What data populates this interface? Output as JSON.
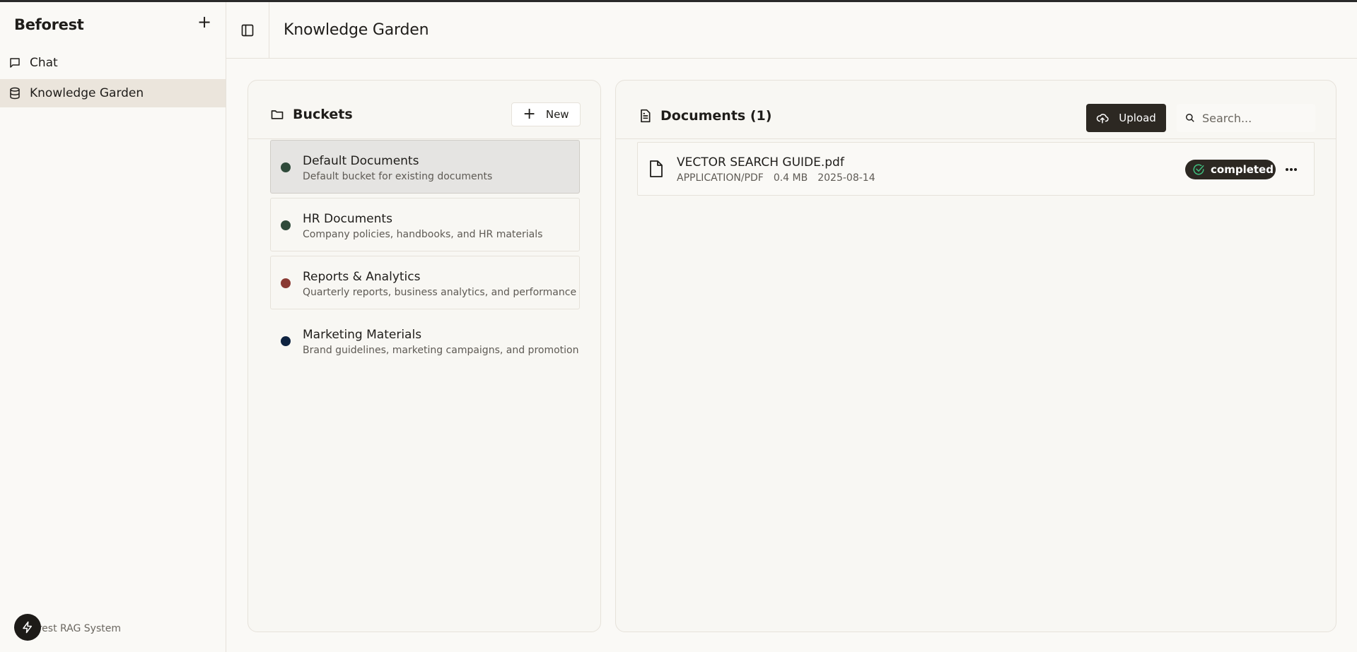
{
  "sidebar": {
    "brand": "Beforest",
    "add_label": "+",
    "items": [
      {
        "label": "Chat",
        "icon": "chat-icon",
        "active": false
      },
      {
        "label": "Knowledge Garden",
        "icon": "database-icon",
        "active": true
      }
    ],
    "footer": "Beforest RAG System"
  },
  "header": {
    "title": "Knowledge Garden"
  },
  "buckets": {
    "title": "Buckets",
    "new_label": "New",
    "items": [
      {
        "name": "Default Documents",
        "desc": "Default bucket for existing documents",
        "color": "#2f4a3a",
        "state": "selected"
      },
      {
        "name": "HR Documents",
        "desc": "Company policies, handbooks, and HR materials",
        "color": "#2f4a3a",
        "state": "bordered"
      },
      {
        "name": "Reports & Analytics",
        "desc": "Quarterly reports, business analytics, and performance dat",
        "color": "#8a3a33",
        "state": "bordered"
      },
      {
        "name": "Marketing Materials",
        "desc": "Brand guidelines, marketing campaigns, and promotional co",
        "color": "#0e2340",
        "state": "plain"
      }
    ]
  },
  "documents": {
    "title": "Documents (1)",
    "upload_label": "Upload",
    "search_placeholder": "Search...",
    "items": [
      {
        "name": "VECTOR SEARCH GUIDE.pdf",
        "type": "APPLICATION/PDF",
        "size": "0.4 MB",
        "date": "2025-08-14",
        "status": "completed",
        "status_color": "#3fbf7f"
      }
    ]
  }
}
